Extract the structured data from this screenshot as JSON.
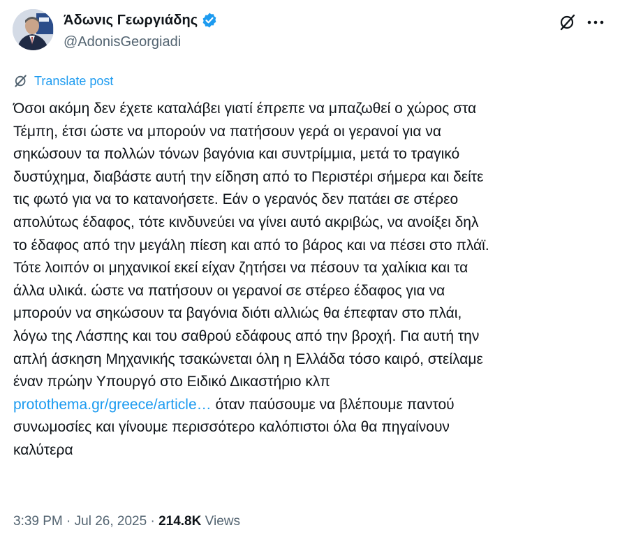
{
  "author": {
    "name": "Άδωνις Γεωργιάδης",
    "handle": "@AdonisGeorgiadi",
    "verified": true
  },
  "actions": {
    "grok_icon": "grok-icon",
    "more_icon": "more-options-icon"
  },
  "translate": {
    "icon": "translate-icon",
    "label": "Translate post"
  },
  "tweet": {
    "line1": "Όσοι ακόμη δεν έχετε καταλάβει γιατί έπρεπε να μπαζωθεί ο χώρος στα",
    "line2": "Τέμπη, έτσι ώστε να μπορούν να πατήσουν γερά οι γερανοί για να",
    "line3": "σηκώσουν τα πολλών τόνων βαγόνια και συντρίμμια, μετά το τραγικό",
    "line4": "δυστύχημα, διαβάστε αυτή την είδηση από το Περιστέρι σήμερα και δείτε",
    "line5": "τις φωτό για να το κατανοήσετε. Εάν ο γερανός δεν πατάει σε στέρεο",
    "line6": "απολύτως έδαφος, τότε κινδυνεύει να γίνει αυτό ακριβώς, να ανοίξει δηλ",
    "line7": "το έδαφος από την μεγάλη πίεση και από το βάρος και να πέσει στο πλάϊ.",
    "line8": "Τότε λοιπόν οι μηχανικοί εκεί είχαν ζητήσει να πέσουν τα χαλίκια και τα",
    "line9": "άλλα υλικά. ώστε να πατήσουν οι γερανοί σε στέρεο έδαφος για να",
    "line10": "μπορούν να σηκώσουν τα βαγόνια διότι αλλιώς θα έπεφταν στο πλάι,",
    "line11": "λόγω της Λάσπης και του σαθρού εδάφους από την βροχή. Για αυτή την",
    "line12": "απλή άσκηση Μηχανικής τσακώνεται όλη η Ελλάδα τόσο καιρό, στείλαμε",
    "line13": "έναν πρώην Υπουργό στο Ειδικό Δικαστήριο κλπ",
    "link": "protothema.gr/greece/article…",
    "after_link": " όταν παύσουμε να βλέπουμε παντού",
    "line15": "συνωμοσίες και γίνουμε περισσότερο καλόπιστοι όλα θα πηγαίνουν",
    "line16": "καλύτερα"
  },
  "meta": {
    "time": "3:39 PM",
    "separator": " · ",
    "date": "Jul 26, 2025",
    "views_count": "214.8K",
    "views_label": " Views"
  },
  "colors": {
    "accent": "#1d9bf0",
    "text": "#0f1419",
    "secondary": "#536471"
  }
}
